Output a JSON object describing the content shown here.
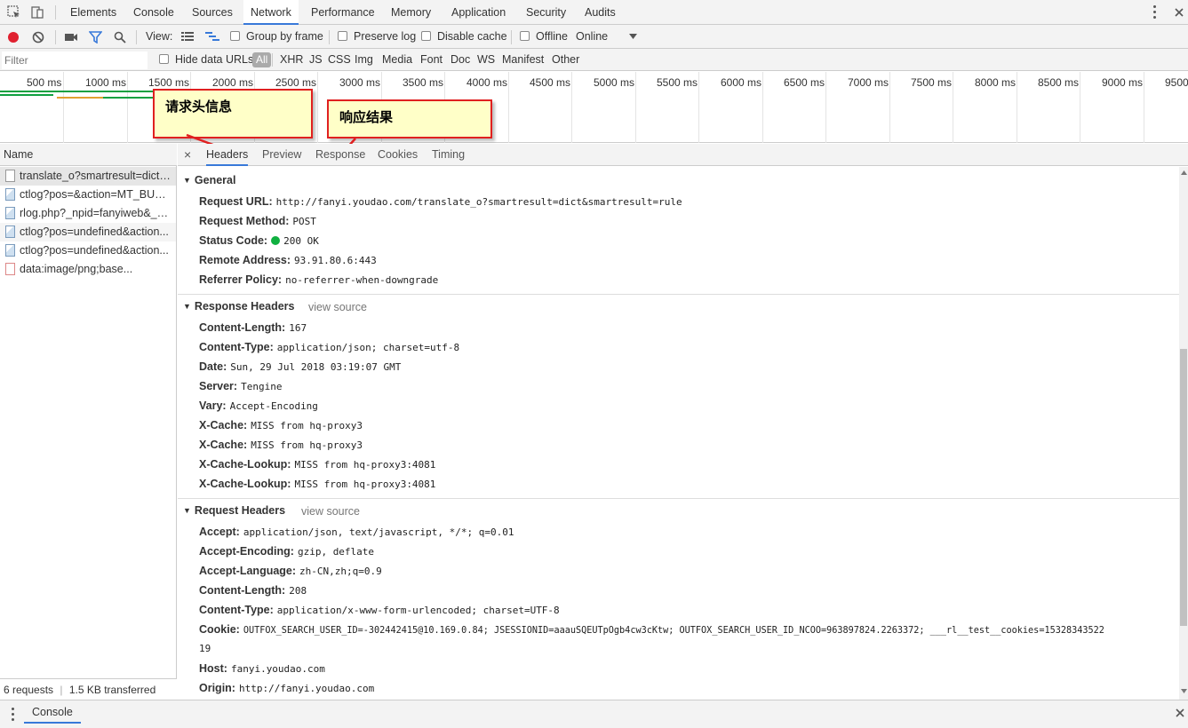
{
  "main_tabs": [
    "Elements",
    "Console",
    "Sources",
    "Network",
    "Performance",
    "Memory",
    "Application",
    "Security",
    "Audits"
  ],
  "active_tab": "Network",
  "toolbar": {
    "view_label": "View:",
    "group_by_frame": "Group by frame",
    "preserve_log": "Preserve log",
    "disable_cache": "Disable cache",
    "offline": "Offline",
    "throttle": "Online"
  },
  "filterbar": {
    "placeholder": "Filter",
    "hide_data_urls": "Hide data URLs",
    "types": [
      "All",
      "XHR",
      "JS",
      "CSS",
      "Img",
      "Media",
      "Font",
      "Doc",
      "WS",
      "Manifest",
      "Other"
    ]
  },
  "timeline": {
    "ticks": [
      "500 ms",
      "1000 ms",
      "1500 ms",
      "2000 ms",
      "2500 ms",
      "3000 ms",
      "3500 ms",
      "4000 ms",
      "4500 ms",
      "5000 ms",
      "5500 ms",
      "6000 ms",
      "6500 ms",
      "7000 ms",
      "7500 ms",
      "8000 ms",
      "8500 ms",
      "9000 ms",
      "9500"
    ]
  },
  "callouts": {
    "request_headers": "请求头信息",
    "response_result": "响应结果"
  },
  "request_list": {
    "header": "Name",
    "items": [
      "translate_o?smartresult=dict&...",
      "ctlog?pos=&action=MT_BUTT...",
      "rlog.php?_npid=fanyiweb&_nc...",
      "ctlog?pos=undefined&action...",
      "ctlog?pos=undefined&action...",
      "data:image/png;base..."
    ],
    "footer_count": "6 requests",
    "footer_sep": "|",
    "footer_size": "1.5 KB transferred"
  },
  "detail_tabs": [
    "Headers",
    "Preview",
    "Response",
    "Cookies",
    "Timing"
  ],
  "detail_close": "×",
  "general": {
    "title": "General",
    "rows": [
      {
        "k": "Request URL:",
        "v": "http://fanyi.youdao.com/translate_o?smartresult=dict&smartresult=rule"
      },
      {
        "k": "Request Method:",
        "v": "POST"
      },
      {
        "k": "Status Code:",
        "v": "200 OK"
      },
      {
        "k": "Remote Address:",
        "v": "93.91.80.6:443"
      },
      {
        "k": "Referrer Policy:",
        "v": "no-referrer-when-downgrade"
      }
    ]
  },
  "response_headers": {
    "title": "Response Headers",
    "view_source": "view source",
    "rows": [
      {
        "k": "Content-Length:",
        "v": "167"
      },
      {
        "k": "Content-Type:",
        "v": "application/json; charset=utf-8"
      },
      {
        "k": "Date:",
        "v": "Sun, 29 Jul 2018 03:19:07 GMT"
      },
      {
        "k": "Server:",
        "v": "Tengine"
      },
      {
        "k": "Vary:",
        "v": "Accept-Encoding"
      },
      {
        "k": "X-Cache:",
        "v": "MISS from hq-proxy3"
      },
      {
        "k": "X-Cache:",
        "v": "MISS from hq-proxy3"
      },
      {
        "k": "X-Cache-Lookup:",
        "v": "MISS from hq-proxy3:4081"
      },
      {
        "k": "X-Cache-Lookup:",
        "v": "MISS from hq-proxy3:4081"
      }
    ]
  },
  "request_headers": {
    "title": "Request Headers",
    "view_source": "view source",
    "rows": [
      {
        "k": "Accept:",
        "v": "application/json, text/javascript, */*; q=0.01"
      },
      {
        "k": "Accept-Encoding:",
        "v": "gzip, deflate"
      },
      {
        "k": "Accept-Language:",
        "v": "zh-CN,zh;q=0.9"
      },
      {
        "k": "Content-Length:",
        "v": "208"
      },
      {
        "k": "Content-Type:",
        "v": "application/x-www-form-urlencoded; charset=UTF-8"
      },
      {
        "k": "Cookie:",
        "v": "OUTFOX_SEARCH_USER_ID=-302442415@10.169.0.84; JSESSIONID=aaauSQEUTpOgb4cw3cKtw; OUTFOX_SEARCH_USER_ID_NCOO=963897824.2263372; ___rl__test__cookies=15328343522"
      },
      {
        "k": "Host:",
        "v": "fanyi.youdao.com"
      },
      {
        "k": "Origin:",
        "v": "http://fanyi.youdao.com"
      }
    ],
    "cookie_cont": "19"
  },
  "drawer": {
    "tab": "Console"
  },
  "colors": {
    "accent": "#3879d9",
    "record": "#e0202f",
    "status_ok": "#10b040",
    "callout_border": "#e02020",
    "callout_bg": "#ffffc8"
  }
}
